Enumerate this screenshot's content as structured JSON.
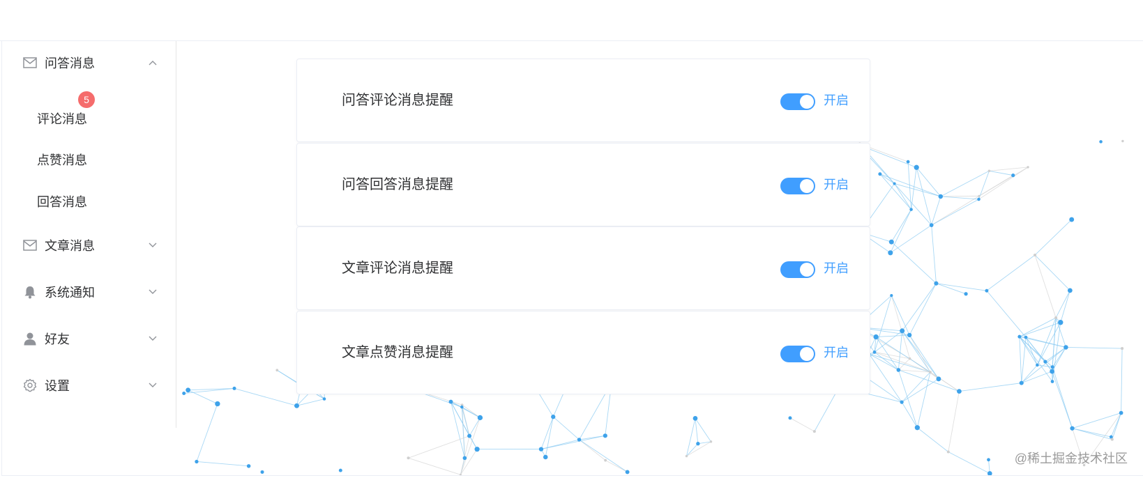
{
  "sidebar": {
    "groups": [
      {
        "label": "问答消息",
        "icon": "mail-icon",
        "expanded": true,
        "badge": "5",
        "items": [
          {
            "label": "评论消息"
          },
          {
            "label": "点赞消息"
          },
          {
            "label": "回答消息"
          }
        ]
      },
      {
        "label": "文章消息",
        "icon": "mail-icon",
        "expanded": false
      },
      {
        "label": "系统通知",
        "icon": "bell-icon",
        "expanded": false
      },
      {
        "label": "好友",
        "icon": "user-icon",
        "expanded": false
      },
      {
        "label": "设置",
        "icon": "gear-icon",
        "expanded": false
      }
    ]
  },
  "settings": [
    {
      "label": "问答评论消息提醒",
      "state": "开启",
      "enabled": true
    },
    {
      "label": "问答回答消息提醒",
      "state": "开启",
      "enabled": true
    },
    {
      "label": "文章评论消息提醒",
      "state": "开启",
      "enabled": true
    },
    {
      "label": "文章点赞消息提醒",
      "state": "开启",
      "enabled": true
    }
  ],
  "watermark": "@稀土掘金技术社区",
  "colors": {
    "accent": "#409eff",
    "badge": "#f56c6c",
    "icon": "#909399",
    "text": "#303133"
  }
}
